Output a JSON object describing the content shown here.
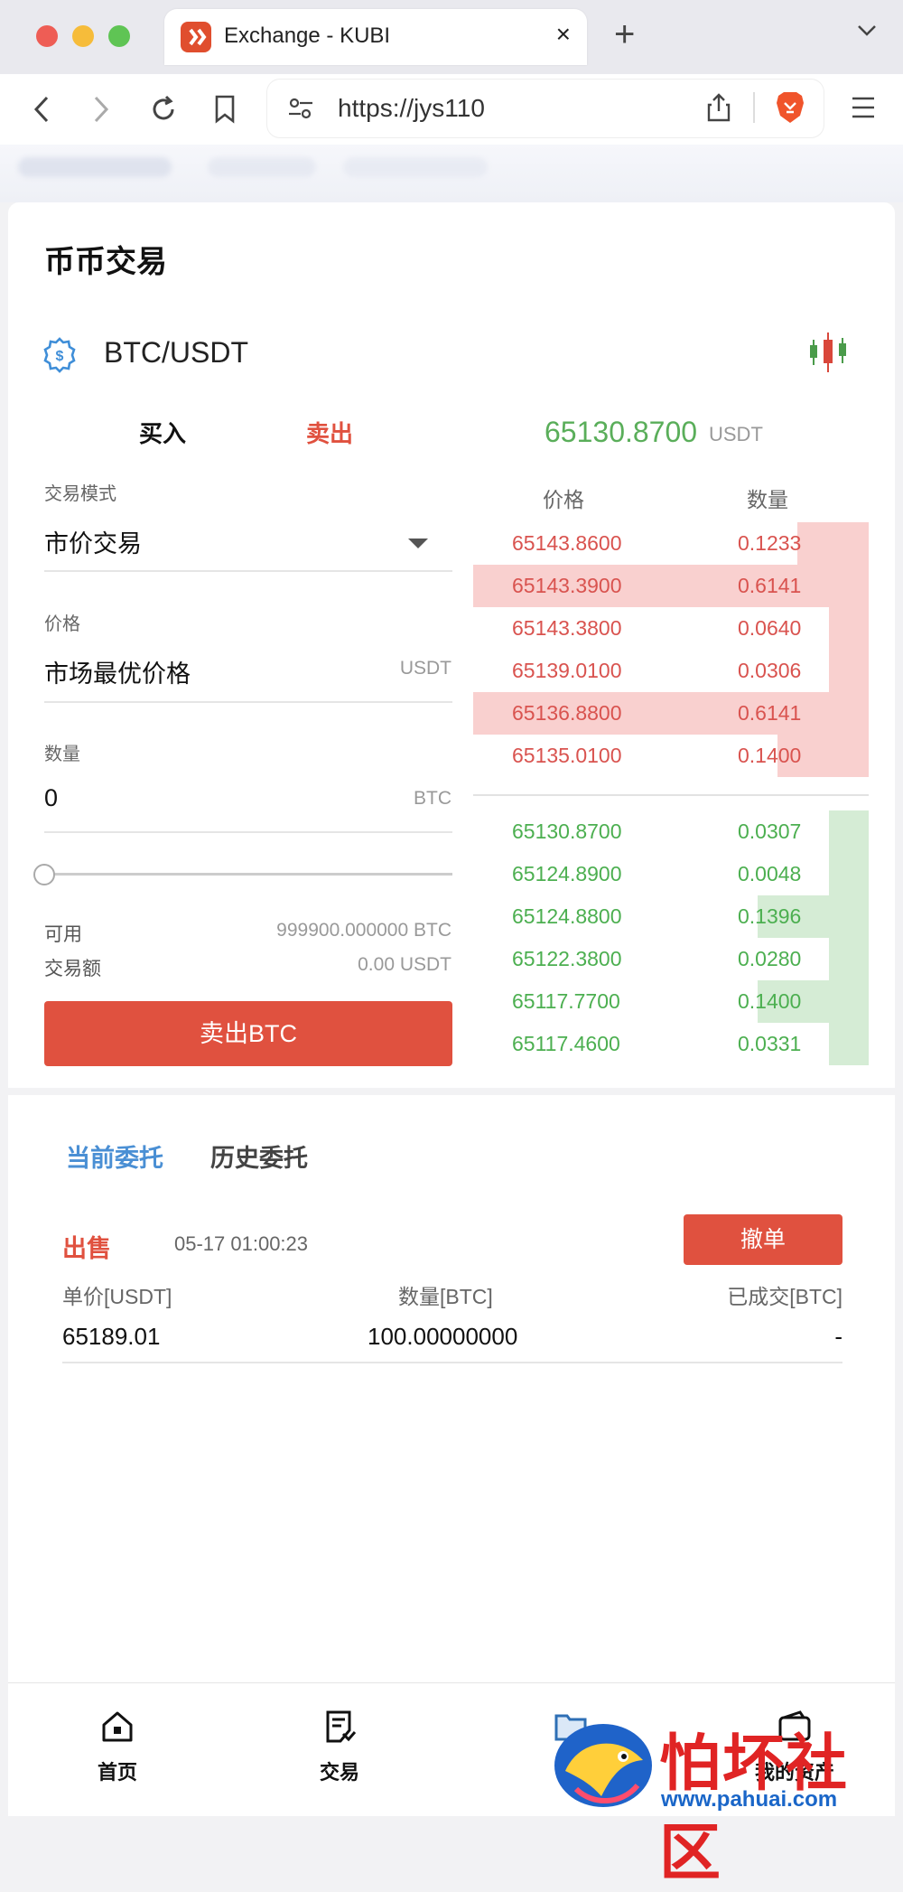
{
  "browser": {
    "tab_title": "Exchange - KUBI",
    "url": "https://jys110",
    "colors": {
      "close": "#ee5d55",
      "minimize": "#f6bc3a",
      "maximize": "#5fc454"
    }
  },
  "page": {
    "title": "币币交易",
    "pair": "BTC/USDT",
    "pair_icon": "gear-dollar-icon",
    "chart_icon": "candlestick-icon"
  },
  "trade": {
    "buy_tab": "买入",
    "sell_tab": "卖出",
    "mode_label": "交易模式",
    "mode_value": "市价交易",
    "price_label": "价格",
    "price_value": "市场最优价格",
    "price_unit": "USDT",
    "qty_label": "数量",
    "qty_value": "0",
    "qty_unit": "BTC",
    "slider_percent": 0,
    "available_label": "可用",
    "available_value": "999900.000000 BTC",
    "amount_label": "交易额",
    "amount_value": "0.00 USDT",
    "submit_label": "卖出BTC",
    "accent_color": "#e0513f"
  },
  "orderbook": {
    "last_price": "65130.8700",
    "last_unit": "USDT",
    "price_header": "价格",
    "qty_header": "数量",
    "asks": [
      {
        "price": "65143.8600",
        "qty": "0.1233",
        "depth": 0.18
      },
      {
        "price": "65143.3900",
        "qty": "0.6141",
        "depth": 1.0
      },
      {
        "price": "65143.3800",
        "qty": "0.0640",
        "depth": 0.1
      },
      {
        "price": "65139.0100",
        "qty": "0.0306",
        "depth": 0.1
      },
      {
        "price": "65136.8800",
        "qty": "0.6141",
        "depth": 1.0
      },
      {
        "price": "65135.0100",
        "qty": "0.1400",
        "depth": 0.23
      }
    ],
    "bids": [
      {
        "price": "65130.8700",
        "qty": "0.0307",
        "depth": 0.1
      },
      {
        "price": "65124.8900",
        "qty": "0.0048",
        "depth": 0.1
      },
      {
        "price": "65124.8800",
        "qty": "0.1396",
        "depth": 0.28
      },
      {
        "price": "65122.3800",
        "qty": "0.0280",
        "depth": 0.1
      },
      {
        "price": "65117.7700",
        "qty": "0.1400",
        "depth": 0.28
      },
      {
        "price": "65117.4600",
        "qty": "0.0331",
        "depth": 0.1
      }
    ],
    "ask_color": "#d9534f",
    "bid_color": "#4caf50"
  },
  "orders": {
    "tab_current": "当前委托",
    "tab_history": "历史委托",
    "side": "出售",
    "time": "05-17 01:00:23",
    "cancel_label": "撤单",
    "col_price": "单价[USDT]",
    "col_qty": "数量[BTC]",
    "col_filled": "已成交[BTC]",
    "price": "65189.01",
    "qty": "100.00000000",
    "filled": "-"
  },
  "nav": {
    "home": "首页",
    "trade": "交易",
    "market": "市",
    "assets": "我的资产"
  },
  "watermark": {
    "text": "怕坏社区",
    "url": "www.pahuai.com"
  }
}
